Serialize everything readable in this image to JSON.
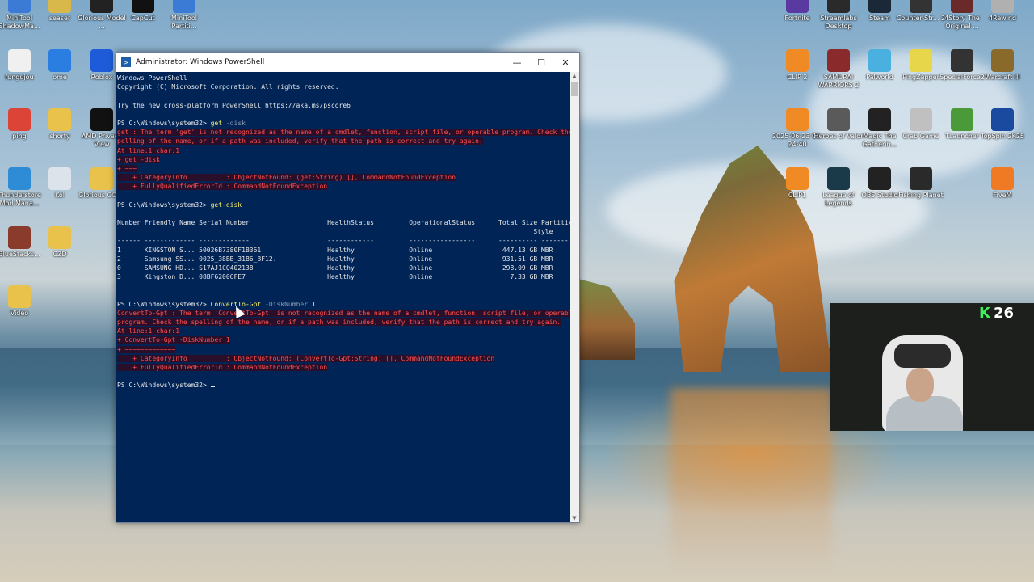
{
  "desktop": {
    "left_icons": [
      {
        "label": "MiniTool ShadowMa...",
        "color": "#3b7bd6"
      },
      {
        "label": "seaser",
        "color": "#d8b84a"
      },
      {
        "label": "Glorious Model ...",
        "color": "#222"
      },
      {
        "label": "CapCut",
        "color": "#111"
      },
      {
        "label": "MiniTool Partiti...",
        "color": "#3b7bd6"
      },
      {
        "label": "fungujou",
        "color": "#f0f0f0"
      },
      {
        "label": "ome",
        "color": "#2a7de1"
      },
      {
        "label": "Roblox",
        "color": "#1e5bd8"
      },
      {
        "label": "ping",
        "color": "#db4437"
      },
      {
        "label": "shorty",
        "color": "#e8c24a"
      },
      {
        "label": "AMD Privacy View",
        "color": "#111"
      },
      {
        "label": "Thunderstore Mod Mana...",
        "color": "#2e8bd6"
      },
      {
        "label": "Kol",
        "color": "#dde3ea"
      },
      {
        "label": "Glorious CORE",
        "color": "#e8c24a"
      },
      {
        "label": "BlueStacks...",
        "color": "#8a3b2b"
      },
      {
        "label": "CZD",
        "color": "#e8c24a"
      },
      {
        "label": "Video",
        "color": "#e8c24a"
      }
    ],
    "right_icons": [
      {
        "label": "Fortnite",
        "color": "#5a3aa0"
      },
      {
        "label": "Streamlabs Desktop",
        "color": "#2a2a2a"
      },
      {
        "label": "Steam",
        "color": "#1b2838"
      },
      {
        "label": "Counter-Str... 2",
        "color": "#333"
      },
      {
        "label": "4Story The Original ...",
        "color": "#6a2a2a"
      },
      {
        "label": "4Rewind",
        "color": "#b0b0b0"
      },
      {
        "label": "CLIP 2",
        "color": "#f08a24"
      },
      {
        "label": "SAMURAI WARRIORS 2",
        "color": "#8a2a2a"
      },
      {
        "label": "Palworld",
        "color": "#4ab0e0"
      },
      {
        "label": "PingZapper",
        "color": "#e8d64a"
      },
      {
        "label": "SpecialForce2",
        "color": "#333"
      },
      {
        "label": "Warcraft III",
        "color": "#8a6a2a"
      },
      {
        "label": "2025-06-23 00-24-40",
        "color": "#f08a24"
      },
      {
        "label": "Heroes of Valor",
        "color": "#5a5a5a"
      },
      {
        "label": "Magic The Gatherin...",
        "color": "#222"
      },
      {
        "label": "Crab Game",
        "color": "#c0c0c0"
      },
      {
        "label": "TLauncher",
        "color": "#4a9a3a"
      },
      {
        "label": "TopSpin 2K25",
        "color": "#1a4aa0"
      },
      {
        "label": "CLIP1",
        "color": "#f08a24"
      },
      {
        "label": "League of Legends",
        "color": "#1a3a4a"
      },
      {
        "label": "OBS Studio",
        "color": "#222"
      },
      {
        "label": "Fishing Planet",
        "color": "#2a2a2a"
      },
      {
        "label": "FiveM",
        "color": "#f07a24"
      }
    ]
  },
  "powershell": {
    "title": "Administrator: Windows PowerShell",
    "minimize": "—",
    "maximize": "☐",
    "close": "✕",
    "lines": [
      {
        "segs": [
          {
            "t": "Windows PowerShell",
            "c": ""
          }
        ]
      },
      {
        "segs": [
          {
            "t": "Copyright (C) Microsoft Corporation. All rights reserved.",
            "c": ""
          }
        ]
      },
      {
        "segs": [
          {
            "t": "",
            "c": ""
          }
        ]
      },
      {
        "segs": [
          {
            "t": "Try the new cross-platform PowerShell https://aka.ms/pscore6",
            "c": ""
          }
        ]
      },
      {
        "segs": [
          {
            "t": "",
            "c": ""
          }
        ]
      },
      {
        "segs": [
          {
            "t": "PS C:\\Windows\\system32> ",
            "c": ""
          },
          {
            "t": "get",
            "c": "cmd"
          },
          {
            "t": " -disk",
            "c": "param"
          }
        ]
      },
      {
        "segs": [
          {
            "t": "get : The term 'get' is not recognized as the name of a cmdlet, function, script file, or operable program. Check the s",
            "c": "err"
          }
        ]
      },
      {
        "segs": [
          {
            "t": "pelling of the name, or if a path was included, verify that the path is correct and try again.",
            "c": "err"
          }
        ]
      },
      {
        "segs": [
          {
            "t": "At line:1 char:1",
            "c": "err"
          }
        ]
      },
      {
        "segs": [
          {
            "t": "+ get -disk",
            "c": "err"
          }
        ]
      },
      {
        "segs": [
          {
            "t": "+ ~~~",
            "c": "err"
          }
        ]
      },
      {
        "segs": [
          {
            "t": "    + CategoryInfo          : ObjectNotFound: (get:String) [], CommandNotFoundException",
            "c": "err"
          }
        ]
      },
      {
        "segs": [
          {
            "t": "    + FullyQualifiedErrorId : CommandNotFoundException",
            "c": "err"
          }
        ]
      },
      {
        "segs": [
          {
            "t": "",
            "c": ""
          }
        ]
      },
      {
        "segs": [
          {
            "t": "PS C:\\Windows\\system32> ",
            "c": ""
          },
          {
            "t": "get-disk",
            "c": "cmd"
          }
        ]
      },
      {
        "segs": [
          {
            "t": "",
            "c": ""
          }
        ]
      },
      {
        "segs": [
          {
            "t": "Number Friendly Name Serial Number                    HealthStatus         OperationalStatus      Total Size Partition",
            "c": ""
          }
        ]
      },
      {
        "segs": [
          {
            "t": "                                                                                                           Style",
            "c": ""
          }
        ]
      },
      {
        "segs": [
          {
            "t": "------ ------------- -------------                    ------------         -----------------      ---------- ----------",
            "c": ""
          }
        ]
      },
      {
        "segs": [
          {
            "t": "1      KINGSTON S... 50026B7380F1B361                 Healthy              Online                  447.13 GB MBR",
            "c": ""
          }
        ]
      },
      {
        "segs": [
          {
            "t": "2      Samsung SS... 0025_38BB_31B6_BF12.             Healthy              Online                  931.51 GB MBR",
            "c": ""
          }
        ]
      },
      {
        "segs": [
          {
            "t": "0      SAMSUNG HD... S17AJ1CQ402138                   Healthy              Online                  298.09 GB MBR",
            "c": ""
          }
        ]
      },
      {
        "segs": [
          {
            "t": "3      Kingston D... 08BF62006FE7                     Healthy              Online                    7.33 GB MBR",
            "c": ""
          }
        ]
      },
      {
        "segs": [
          {
            "t": "",
            "c": ""
          }
        ]
      },
      {
        "segs": [
          {
            "t": "",
            "c": ""
          }
        ]
      },
      {
        "segs": [
          {
            "t": "PS C:\\Windows\\system32> ",
            "c": ""
          },
          {
            "t": "ConvertTo-Gpt",
            "c": "cmd"
          },
          {
            "t": " -DiskNumber",
            "c": "param"
          },
          {
            "t": " 1",
            "c": ""
          }
        ]
      },
      {
        "segs": [
          {
            "t": "ConvertTo-Gpt : The term 'ConvertTo-Gpt' is not recognized as the name of a cmdlet, function, script file, or operable",
            "c": "err"
          }
        ]
      },
      {
        "segs": [
          {
            "t": "program. Check the spelling of the name, or if a path was included, verify that the path is correct and try again.",
            "c": "err"
          }
        ]
      },
      {
        "segs": [
          {
            "t": "At line:1 char:1",
            "c": "err"
          }
        ]
      },
      {
        "segs": [
          {
            "t": "+ ConvertTo-Gpt -DiskNumber 1",
            "c": "err"
          }
        ]
      },
      {
        "segs": [
          {
            "t": "+ ~~~~~~~~~~~~~",
            "c": "err"
          }
        ]
      },
      {
        "segs": [
          {
            "t": "    + CategoryInfo          : ObjectNotFound: (ConvertTo-Gpt:String) [], CommandNotFoundException",
            "c": "err"
          }
        ]
      },
      {
        "segs": [
          {
            "t": "    + FullyQualifiedErrorId : CommandNotFoundException",
            "c": "err"
          }
        ]
      },
      {
        "segs": [
          {
            "t": "",
            "c": ""
          }
        ]
      },
      {
        "segs": [
          {
            "t": "PS C:\\Windows\\system32> ",
            "c": ""
          }
        ]
      }
    ]
  },
  "overlay": {
    "kick_logo": "K",
    "viewer_count": "26"
  }
}
